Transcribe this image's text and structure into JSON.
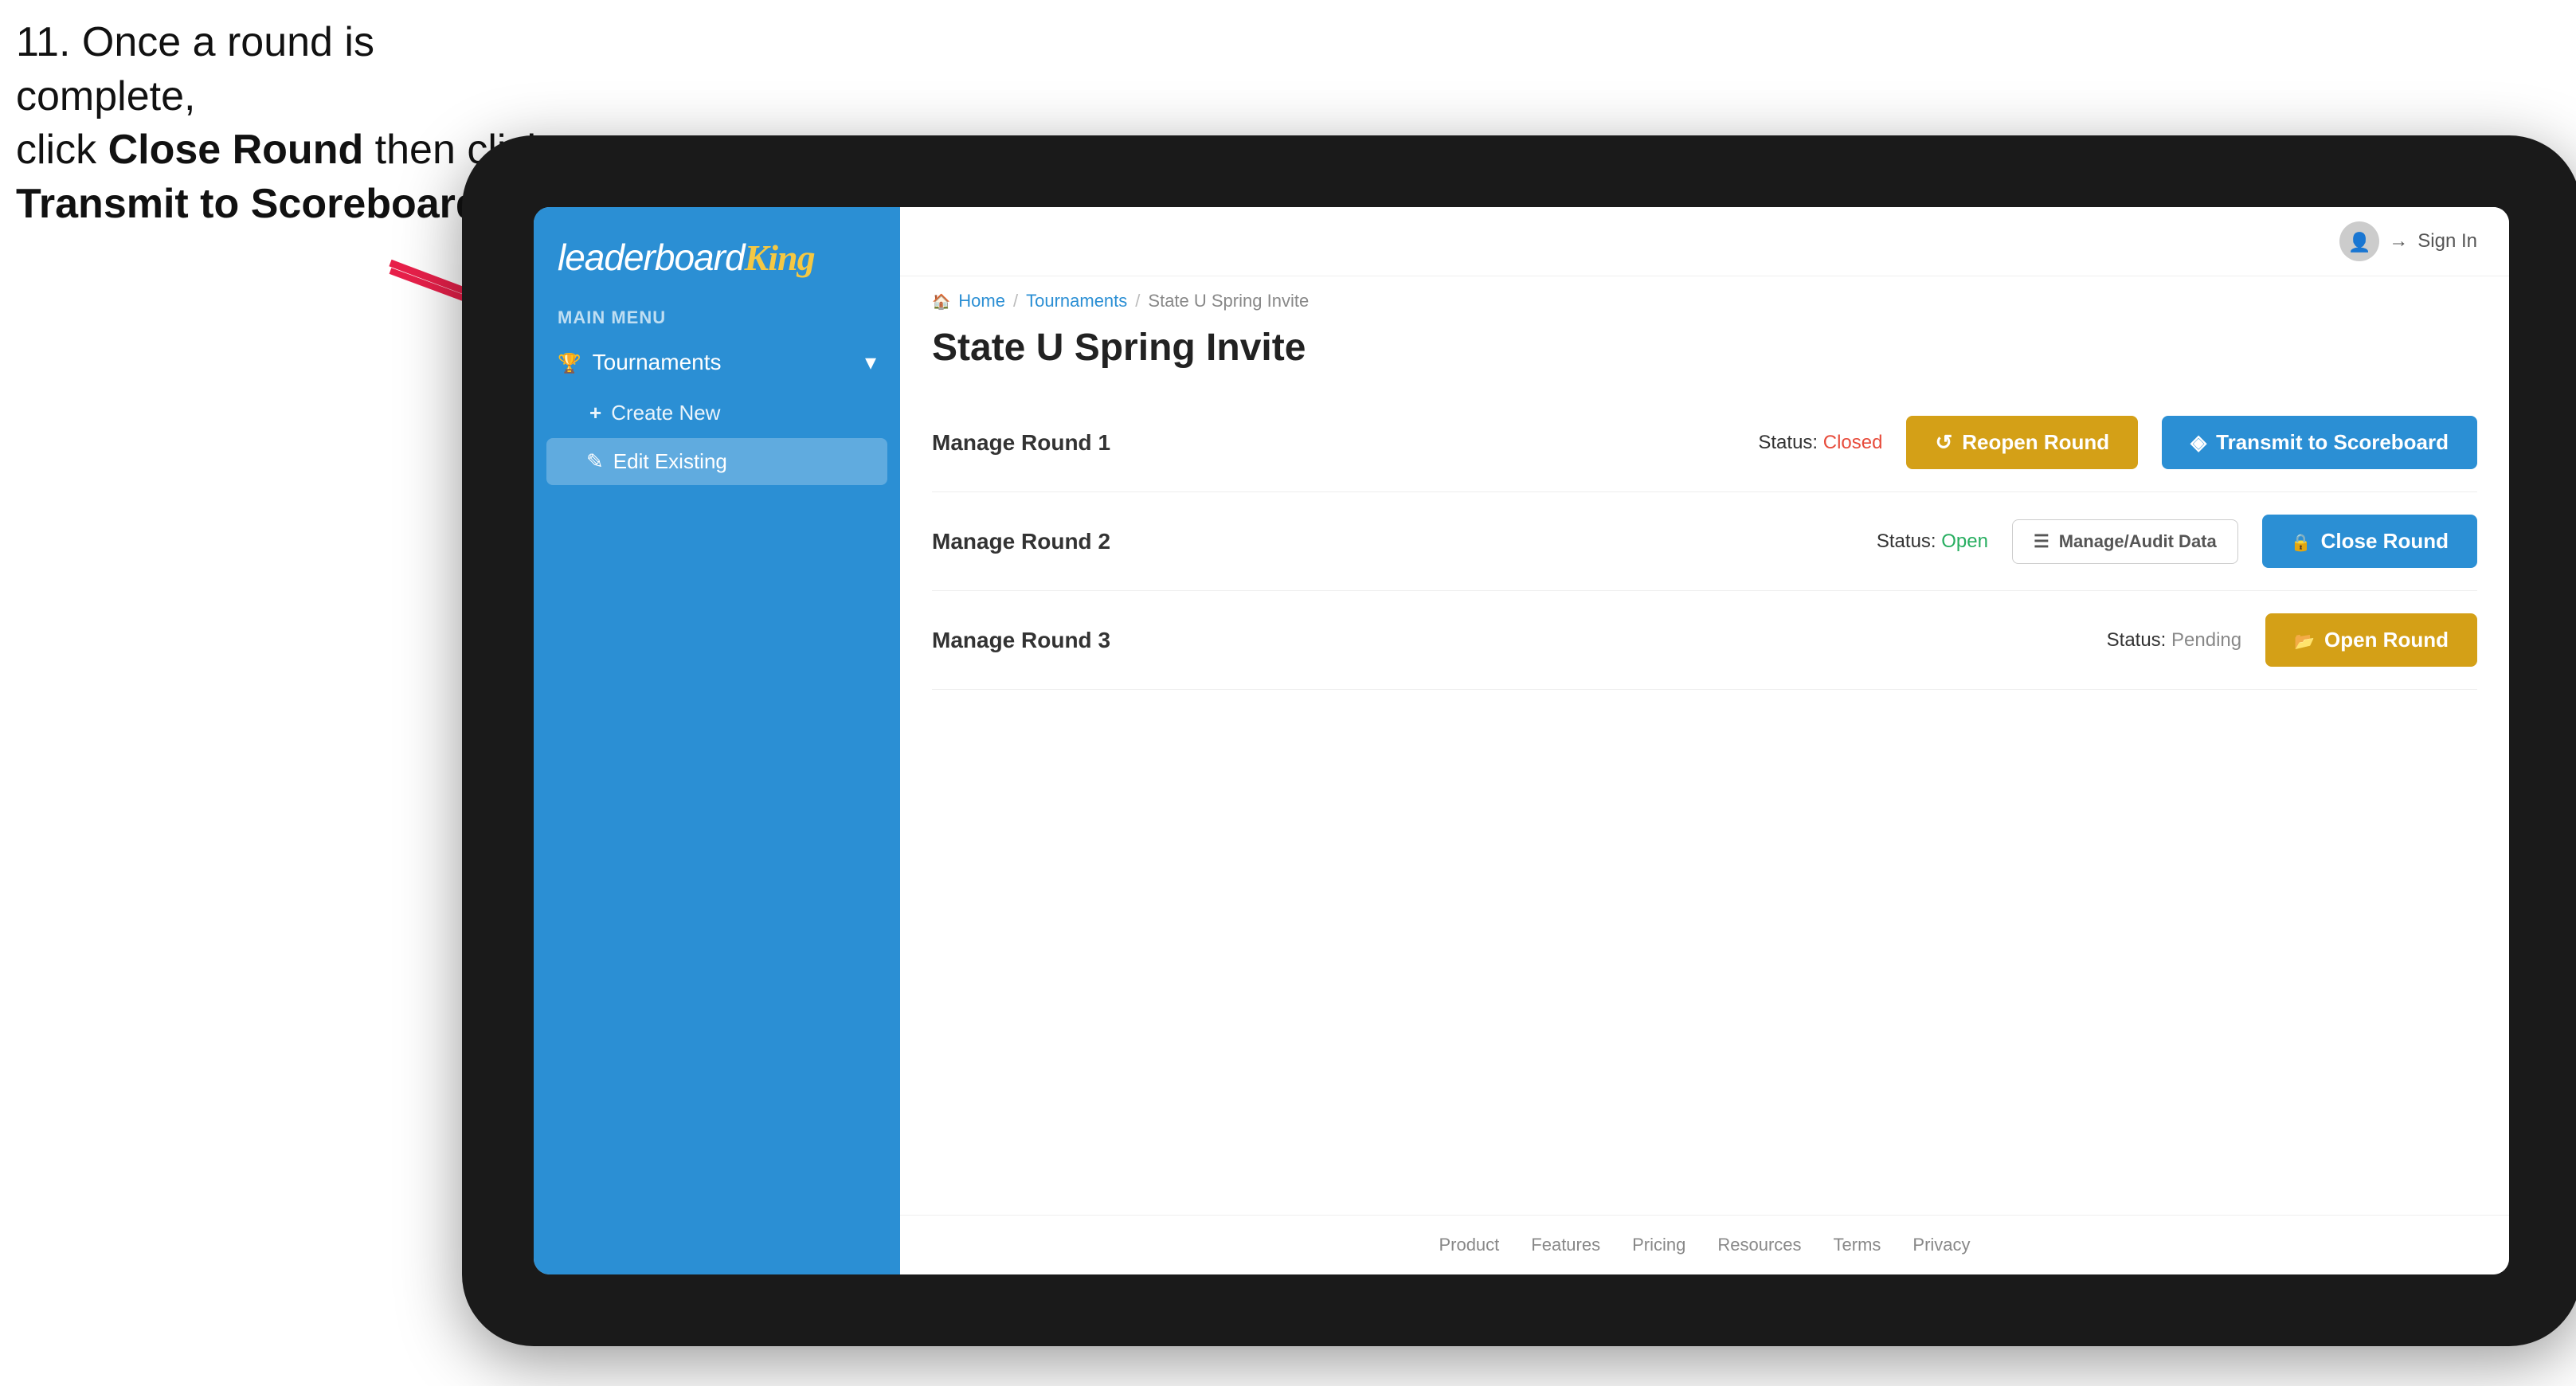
{
  "instruction": {
    "line1": "11. Once a round is complete,",
    "line2": "click Close Round then click",
    "line3": "Transmit to Scoreboard."
  },
  "tablet": {
    "sidebar": {
      "logo": {
        "leaderboard": "leaderboard",
        "king": "King"
      },
      "menu_label": "MAIN MENU",
      "items": [
        {
          "id": "tournaments",
          "label": "Tournaments",
          "expanded": true,
          "sub_items": [
            {
              "id": "create-new",
              "label": "Create New"
            },
            {
              "id": "edit-existing",
              "label": "Edit Existing",
              "active": true
            }
          ]
        }
      ]
    },
    "header": {
      "sign_in_label": "Sign In"
    },
    "breadcrumb": {
      "home": "Home",
      "tournaments": "Tournaments",
      "current": "State U Spring Invite"
    },
    "page_title": "State U Spring Invite",
    "rounds": [
      {
        "id": "round-1",
        "label": "Manage Round 1",
        "status_label": "Status:",
        "status_value": "Closed",
        "status_class": "status-closed",
        "buttons": [
          {
            "id": "reopen-round",
            "label": "Reopen Round",
            "style": "btn-gold"
          },
          {
            "id": "transmit-scoreboard",
            "label": "Transmit to Scoreboard",
            "style": "btn-blue"
          }
        ]
      },
      {
        "id": "round-2",
        "label": "Manage Round 2",
        "status_label": "Status:",
        "status_value": "Open",
        "status_class": "status-open",
        "buttons": [
          {
            "id": "manage-audit",
            "label": "Manage/Audit Data",
            "style": "btn-manage"
          },
          {
            "id": "close-round",
            "label": "Close Round",
            "style": "btn-blue"
          }
        ]
      },
      {
        "id": "round-3",
        "label": "Manage Round 3",
        "status_label": "Status:",
        "status_value": "Pending",
        "status_class": "status-pending",
        "buttons": [
          {
            "id": "open-round",
            "label": "Open Round",
            "style": "btn-gold"
          }
        ]
      }
    ],
    "footer": {
      "links": [
        "Product",
        "Features",
        "Pricing",
        "Resources",
        "Terms",
        "Privacy"
      ]
    }
  }
}
